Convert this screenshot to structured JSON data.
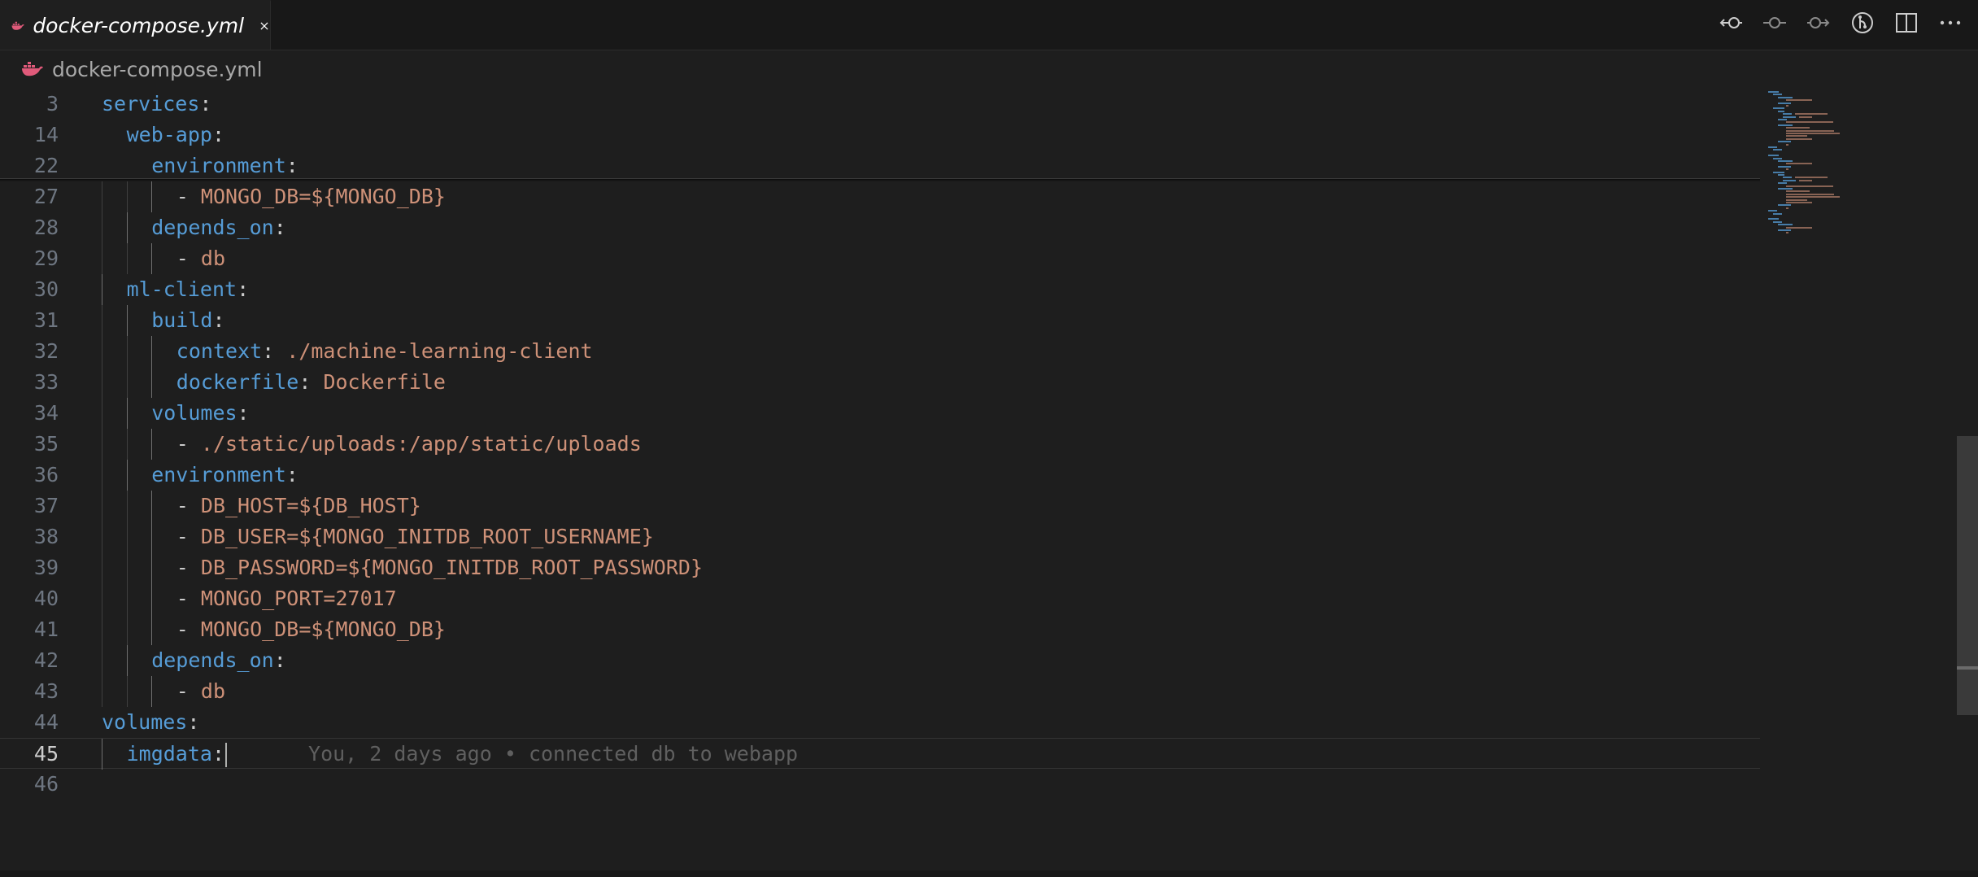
{
  "tab": {
    "title": "docker-compose.yml",
    "icon": "docker-icon",
    "accent": "#e05a7a"
  },
  "breadcrumb": {
    "file": "docker-compose.yml"
  },
  "editor": {
    "sticky": [
      {
        "n": "3",
        "indent": 0,
        "key": "services",
        "val": ""
      },
      {
        "n": "14",
        "indent": 1,
        "key": "web-app",
        "val": ""
      },
      {
        "n": "22",
        "indent": 2,
        "key": "environment",
        "val": ""
      }
    ],
    "lines": [
      {
        "n": "27",
        "indent": 3,
        "dash": "- ",
        "val": "MONGO_DB=${MONGO_DB}"
      },
      {
        "n": "28",
        "indent": 2,
        "key": "depends_on"
      },
      {
        "n": "29",
        "indent": 3,
        "dash": "- ",
        "val": "db"
      },
      {
        "n": "30",
        "indent": 1,
        "key": "ml-client"
      },
      {
        "n": "31",
        "indent": 2,
        "key": "build"
      },
      {
        "n": "32",
        "indent": 3,
        "key": "context",
        "val": "./machine-learning-client"
      },
      {
        "n": "33",
        "indent": 3,
        "key": "dockerfile",
        "val": "Dockerfile"
      },
      {
        "n": "34",
        "indent": 2,
        "key": "volumes"
      },
      {
        "n": "35",
        "indent": 3,
        "dash": "- ",
        "val": "./static/uploads:/app/static/uploads"
      },
      {
        "n": "36",
        "indent": 2,
        "key": "environment"
      },
      {
        "n": "37",
        "indent": 3,
        "dash": "- ",
        "val": "DB_HOST=${DB_HOST}"
      },
      {
        "n": "38",
        "indent": 3,
        "dash": "- ",
        "val": "DB_USER=${MONGO_INITDB_ROOT_USERNAME}"
      },
      {
        "n": "39",
        "indent": 3,
        "dash": "- ",
        "val": "DB_PASSWORD=${MONGO_INITDB_ROOT_PASSWORD}"
      },
      {
        "n": "40",
        "indent": 3,
        "dash": "- ",
        "val": "MONGO_PORT=27017"
      },
      {
        "n": "41",
        "indent": 3,
        "dash": "- ",
        "val": "MONGO_DB=${MONGO_DB}"
      },
      {
        "n": "42",
        "indent": 2,
        "key": "depends_on"
      },
      {
        "n": "43",
        "indent": 3,
        "dash": "- ",
        "val": "db"
      },
      {
        "n": "44",
        "indent": 0,
        "key": "volumes"
      },
      {
        "n": "45",
        "indent": 1,
        "key": "imgdata",
        "active": true,
        "blame": "You, 2 days ago • connected db to webapp"
      },
      {
        "n": "46",
        "indent": 0
      }
    ]
  },
  "colors": {
    "keyword": "#569cd6",
    "string": "#ce9178",
    "background": "#1e1e1e"
  }
}
